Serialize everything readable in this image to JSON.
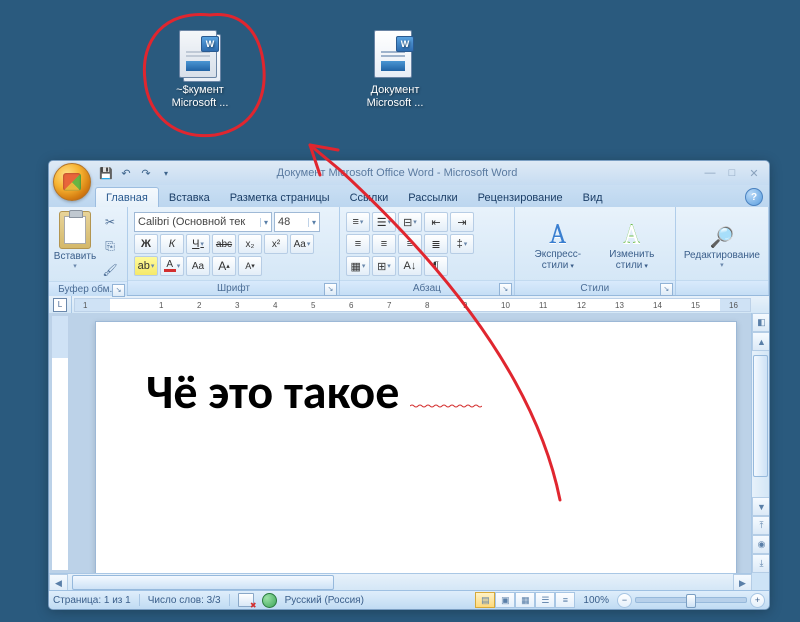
{
  "desktop": {
    "icon1_label": "~$кумент\nMicrosoft ...",
    "icon2_label": "Документ\nMicrosoft ..."
  },
  "window": {
    "title": "Документ Microsoft Office Word - Microsoft Word",
    "tabs": {
      "home": "Главная",
      "insert": "Вставка",
      "layout": "Разметка страницы",
      "references": "Ссылки",
      "mailings": "Рассылки",
      "review": "Рецензирование",
      "view": "Вид"
    },
    "ribbon": {
      "clipboard": {
        "label": "Буфер обм...",
        "paste": "Вставить"
      },
      "font": {
        "label": "Шрифт",
        "name": "Calibri (Основной тек",
        "size": "48",
        "bold": "Ж",
        "italic": "К",
        "underline": "Ч",
        "strike": "abc",
        "subscript": "x₂",
        "superscript": "x²",
        "changecase": "Aa",
        "growfont": "A",
        "shrinkfont": "A"
      },
      "paragraph": {
        "label": "Абзац"
      },
      "styles": {
        "label": "Стили",
        "quick": "Экспресс-стили",
        "change": "Изменить\nстили"
      },
      "editing": {
        "label": "Редактирование"
      }
    },
    "document_text": "Чё это такое",
    "status": {
      "page": "Страница: 1 из 1",
      "words": "Число слов: 3/3",
      "lang": "Русский (Россия)",
      "zoom": "100%"
    },
    "ruler_numbers": [
      "1",
      "",
      "1",
      "2",
      "3",
      "4",
      "5",
      "6",
      "7",
      "8",
      "9",
      "10",
      "11",
      "12",
      "13",
      "14",
      "15",
      "16"
    ]
  }
}
